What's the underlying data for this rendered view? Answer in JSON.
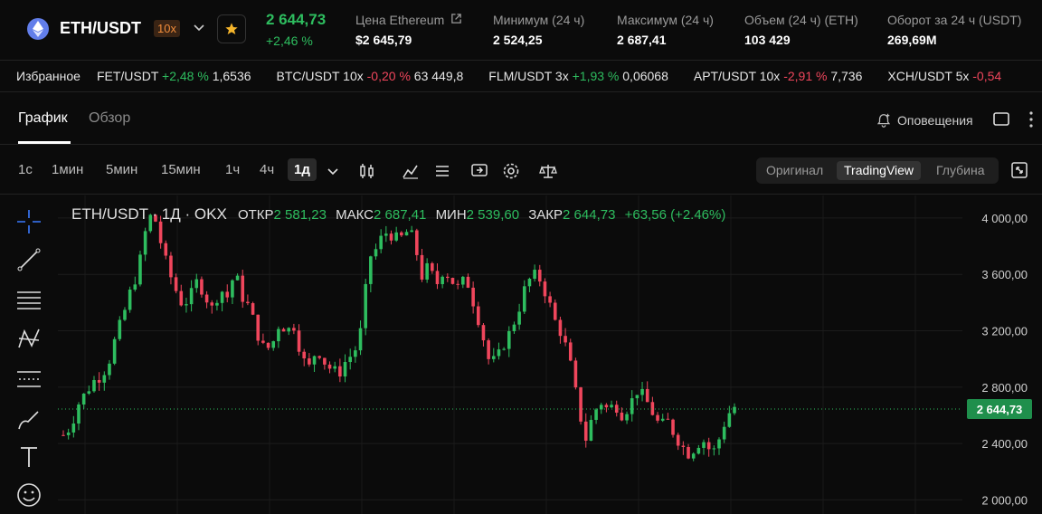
{
  "header": {
    "pair": "ETH/USDT",
    "leverage": "10x",
    "last_price": "2 644,73",
    "change": "+2,46 %",
    "stats": [
      {
        "label": "Цена Ethereum",
        "value": "$2 645,79"
      },
      {
        "label": "Минимум (24 ч)",
        "value": "2 524,25"
      },
      {
        "label": "Максимум (24 ч)",
        "value": "2 687,41"
      },
      {
        "label": "Объем (24 ч) (ETH)",
        "value": "103 429"
      },
      {
        "label": "Оборот за 24 ч (USDT)",
        "value": "269,69M"
      }
    ]
  },
  "ticker": {
    "label": "Избранное",
    "items": [
      {
        "pair": "FET/USDT",
        "change": "+2,48 %",
        "price": "1,6536",
        "dir": "up"
      },
      {
        "pair": "BTC/USDT 10x",
        "change": "-0,20 %",
        "price": "63 449,8",
        "dir": "down"
      },
      {
        "pair": "FLM/USDT 3x",
        "change": "+1,93 %",
        "price": "0,06068",
        "dir": "up"
      },
      {
        "pair": "APT/USDT 10x",
        "change": "-2,91 %",
        "price": "7,736",
        "dir": "down"
      },
      {
        "pair": "XCH/USDT 5x",
        "change": "-0,54",
        "price": "",
        "dir": "down"
      }
    ]
  },
  "tabs": {
    "chart": "График",
    "overview": "Обзор",
    "alerts": "Оповещения"
  },
  "timeframes": [
    "1с",
    "1мин",
    "5мин",
    "15мин",
    "1ч",
    "4ч",
    "1д"
  ],
  "active_timeframe": "1д",
  "view_modes": {
    "original": "Оригинал",
    "tradingview": "TradingView",
    "depth": "Глубина"
  },
  "legend": {
    "symbol": "ETH/USDT · 1Д · OKX",
    "open_label": "ОТКР",
    "open": "2 581,23",
    "high_label": "МАКС",
    "high": "2 687,41",
    "low_label": "МИН",
    "low": "2 539,60",
    "close_label": "ЗАКР",
    "close": "2 644,73",
    "change": "+63,56 (+2.46%)"
  },
  "colors": {
    "up": "#2ebd5f",
    "down": "#f0465c",
    "accent": "#1f8f4c"
  },
  "chart_data": {
    "type": "candlestick",
    "y_ticks": [
      "4 000,00",
      "3 600,00",
      "3 200,00",
      "2 800,00",
      "2 400,00",
      "2 000,00"
    ],
    "y_tick_values": [
      4000,
      3600,
      3200,
      2800,
      2400,
      2000
    ],
    "ylim": [
      1900,
      4160
    ],
    "last_price_label": "2 644,73",
    "last_price": 2644.73,
    "close_trend": [
      2460,
      2520,
      2680,
      2760,
      2840,
      2880,
      2960,
      3150,
      3300,
      3480,
      3620,
      3900,
      4060,
      3840,
      3640,
      3500,
      3380,
      3440,
      3560,
      3450,
      3350,
      3500,
      3440,
      3620,
      3440,
      3360,
      3180,
      3060,
      3100,
      3260,
      3200,
      3240,
      3000,
      2940,
      3080,
      2980,
      2920,
      2900,
      3000,
      3040,
      3220,
      3720,
      3780,
      3900,
      3880,
      3840,
      3900,
      3860,
      3580,
      3660,
      3520,
      3640,
      3560,
      3500,
      3580,
      3400,
      3220,
      3000,
      2980,
      3100,
      3200,
      3340,
      3520,
      3600,
      3560,
      3420,
      3260,
      3160,
      2960,
      2680,
      2420,
      2600,
      2700,
      2640,
      2680,
      2600,
      2680,
      2780,
      2720,
      2620,
      2520,
      2560,
      2460,
      2380,
      2320,
      2400,
      2420,
      2320,
      2440,
      2600,
      2660
    ],
    "candles_visible": 132
  }
}
